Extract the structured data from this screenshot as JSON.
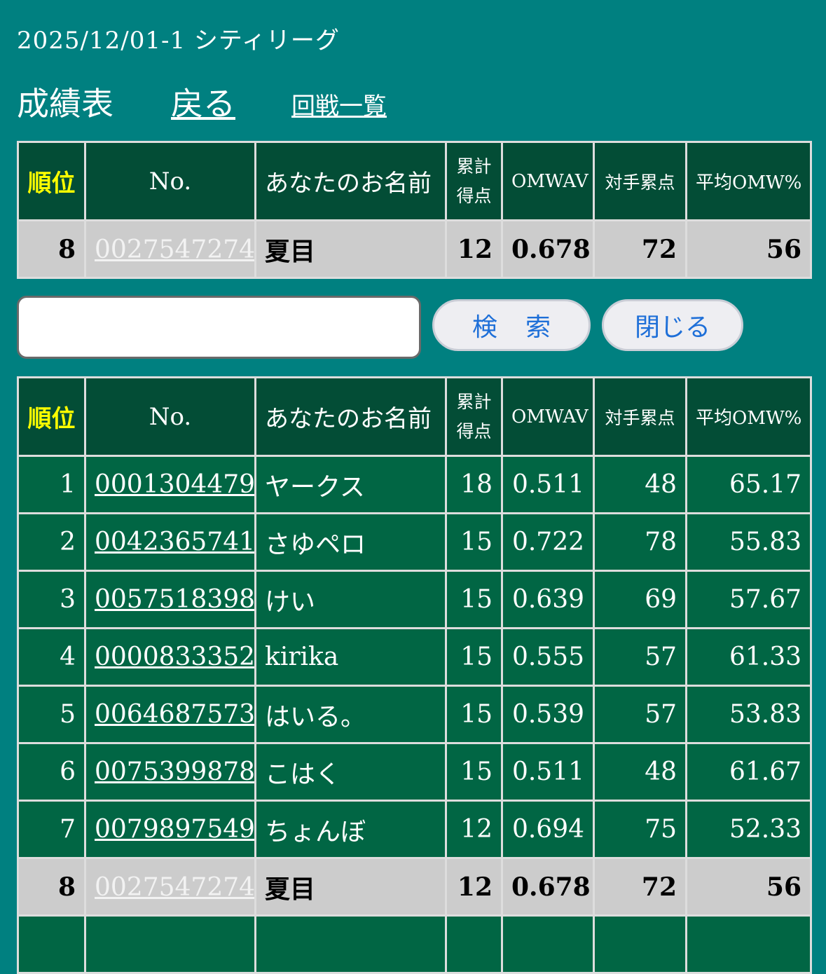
{
  "header": {
    "title": "2025/12/01-1 シティリーグ",
    "nav_main": "成績表",
    "nav_back": "戻る",
    "nav_list": "回戦一覧"
  },
  "columns": {
    "rank": "順位",
    "no": "No.",
    "name": "あなたのお名前",
    "points_line1": "累計",
    "points_line2": "得点",
    "omwav": "OMWAV",
    "opp_points": "対手累点",
    "avg_omw": "平均OMW%"
  },
  "my_result": {
    "rank": "8",
    "no": "0027547274",
    "name": "夏目",
    "points": "12",
    "omwav": "0.678",
    "opp_points": "72",
    "avg_omw": "56"
  },
  "search": {
    "value": "",
    "placeholder": "",
    "search_label": "検索",
    "close_label": "閉じる"
  },
  "standings": [
    {
      "rank": "1",
      "no": "0001304479",
      "name": "ヤークス",
      "points": "18",
      "omwav": "0.511",
      "opp_points": "48",
      "avg_omw": "65.17"
    },
    {
      "rank": "2",
      "no": "0042365741",
      "name": "さゆペロ",
      "points": "15",
      "omwav": "0.722",
      "opp_points": "78",
      "avg_omw": "55.83"
    },
    {
      "rank": "3",
      "no": "0057518398",
      "name": "けい",
      "points": "15",
      "omwav": "0.639",
      "opp_points": "69",
      "avg_omw": "57.67"
    },
    {
      "rank": "4",
      "no": "0000833352",
      "name": "kirika",
      "points": "15",
      "omwav": "0.555",
      "opp_points": "57",
      "avg_omw": "61.33"
    },
    {
      "rank": "5",
      "no": "0064687573",
      "name": "はいる。",
      "points": "15",
      "omwav": "0.539",
      "opp_points": "57",
      "avg_omw": "53.83"
    },
    {
      "rank": "6",
      "no": "0075399878",
      "name": "こはく",
      "points": "15",
      "omwav": "0.511",
      "opp_points": "48",
      "avg_omw": "61.67"
    },
    {
      "rank": "7",
      "no": "0079897549",
      "name": "ちょんぼ",
      "points": "12",
      "omwav": "0.694",
      "opp_points": "75",
      "avg_omw": "52.33"
    },
    {
      "rank": "8",
      "no": "0027547274",
      "name": "夏目",
      "points": "12",
      "omwav": "0.678",
      "opp_points": "72",
      "avg_omw": "56"
    }
  ],
  "colors": {
    "page_background": "#008080",
    "header_background": "#034d36",
    "row_background": "#016644",
    "highlight_row": "#cccccc",
    "rank_header_text": "#ffff00",
    "button_text": "#1e6fd8"
  }
}
